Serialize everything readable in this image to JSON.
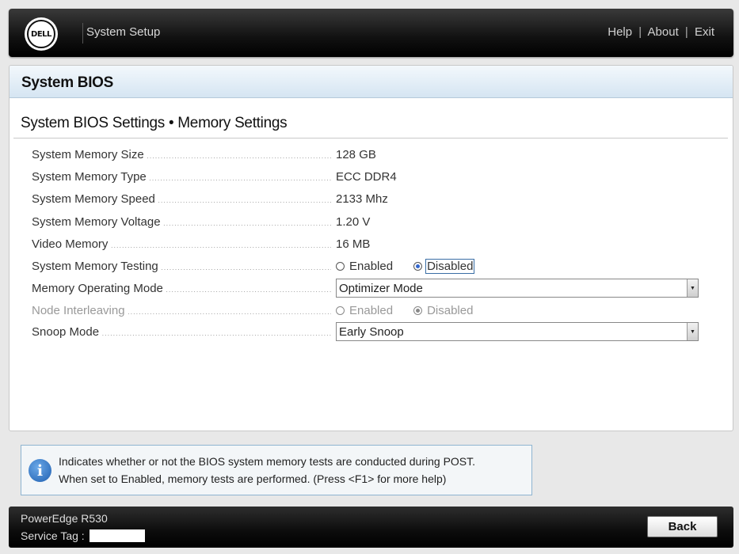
{
  "header": {
    "logo_text": "DELL",
    "title": "System Setup",
    "links": {
      "help": "Help",
      "about": "About",
      "exit": "Exit",
      "sep": "|"
    }
  },
  "panel": {
    "title": "System BIOS",
    "page_title": "System BIOS Settings • Memory Settings"
  },
  "settings": [
    {
      "label": "System Memory Size",
      "value": "128 GB"
    },
    {
      "label": "System Memory Type",
      "value": "ECC DDR4"
    },
    {
      "label": "System Memory Speed",
      "value": "2133 Mhz"
    },
    {
      "label": "System Memory Voltage",
      "value": "1.20 V"
    },
    {
      "label": "Video Memory",
      "value": "16 MB"
    },
    {
      "label": "System Memory Testing",
      "option_enabled": "Enabled",
      "option_disabled": "Disabled",
      "selected": "Disabled"
    },
    {
      "label": "Memory Operating Mode",
      "value": "Optimizer Mode"
    },
    {
      "label": "Node Interleaving",
      "option_enabled": "Enabled",
      "option_disabled": "Disabled",
      "selected": "Disabled",
      "state": "disabled"
    },
    {
      "label": "Snoop Mode",
      "value": "Early Snoop"
    }
  ],
  "help": {
    "icon": "info-icon",
    "icon_glyph": "i",
    "line1": "Indicates whether or not the BIOS system memory tests are conducted during POST.",
    "line2": "When set to Enabled, memory tests are performed. (Press <F1> for more help)"
  },
  "footer": {
    "model": "PowerEdge R530",
    "service_tag_label": "Service Tag :",
    "back_label": "Back"
  },
  "colors": {
    "header_bg": "#000000",
    "panel_title_bg": "#d5e5f2",
    "radio_selected": "#3366cc",
    "help_border": "#8eb4d0",
    "info_icon": "#1f5fb0"
  }
}
